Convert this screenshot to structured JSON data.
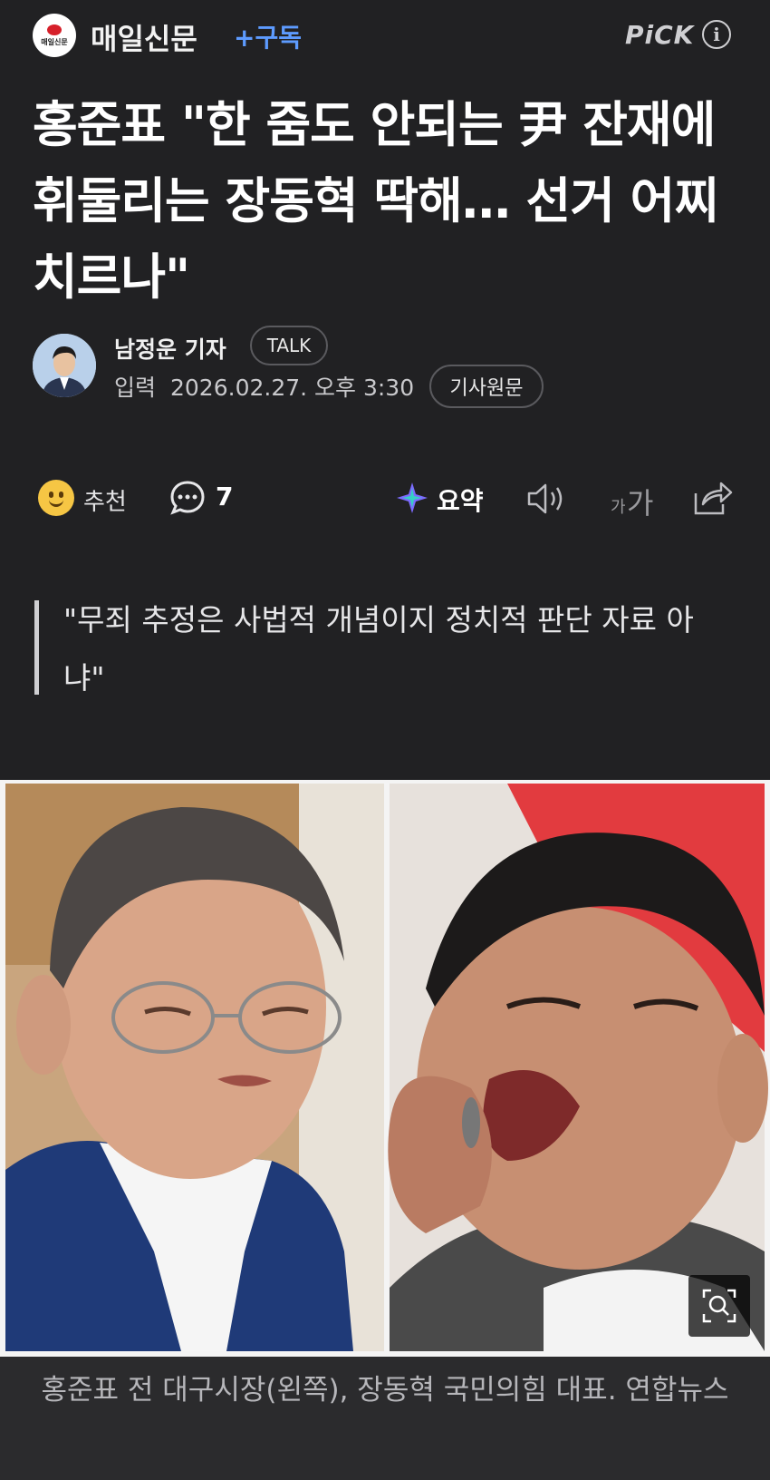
{
  "header": {
    "logo_text": "매일신문",
    "press_name": "매일신문",
    "subscribe_label": "+구독",
    "pick_label": "PiCK",
    "info_glyph": "i"
  },
  "article": {
    "headline": "홍준표 \"한 줌도 안되는 尹 잔재에 휘둘리는 장동혁 딱해… 선거 어찌 치르나\"",
    "reporter_name": "남정운 기자",
    "talk_label": "TALK",
    "date_label": "입력",
    "date_value": "2026.02.27. 오후 3:30",
    "original_label": "기사원문",
    "quote": "\"무죄 추정은 사법적 개념이지 정치적 판단 자료 아냐\"",
    "photo_caption": "홍준표 전 대구시장(왼쪽), 장동혁 국민의힘 대표. 연합뉴스"
  },
  "actions": {
    "recommend_label": "추천",
    "comment_count": "7",
    "summary_label": "요약",
    "font_small": "가",
    "font_large": "가"
  },
  "colors": {
    "background": "#212123",
    "accent_blue": "#5d9bff",
    "caption_bg": "#2b2b2d"
  }
}
